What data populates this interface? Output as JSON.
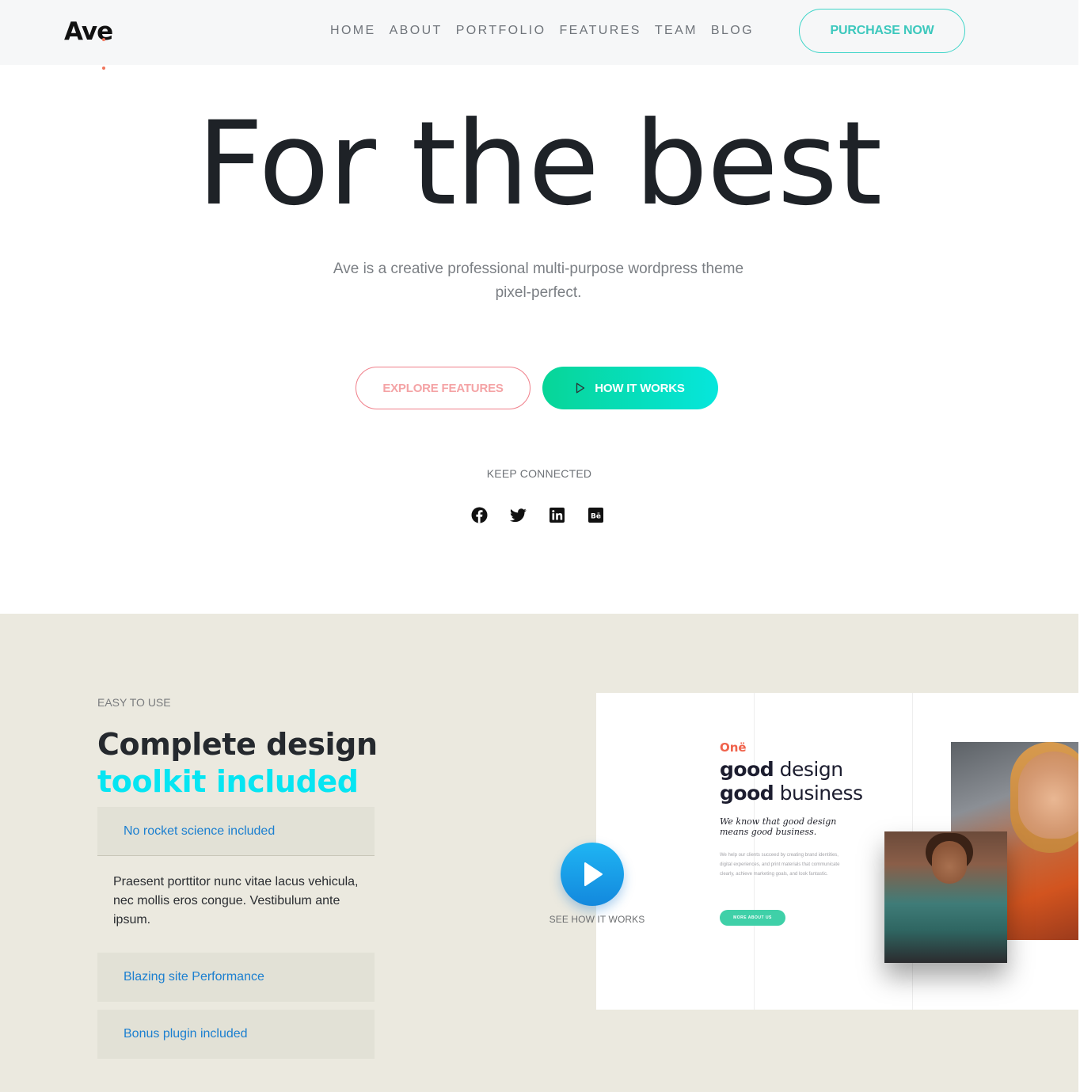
{
  "header": {
    "logo": "Ave",
    "nav": [
      "HOME",
      "ABOUT",
      "PORTFOLIO",
      "FEATURES",
      "TEAM",
      "BLOG"
    ],
    "purchase_label": "PURCHASE NOW"
  },
  "hero": {
    "title": "For the best",
    "subtitle_line1": "Ave is a creative professional multi-purpose wordpress theme",
    "subtitle_line2": "pixel-perfect.",
    "explore_label": "EXPLORE FEATURES",
    "how_label": "HOW IT WORKS",
    "keep_connected": "KEEP CONNECTED",
    "social_icons": [
      "facebook-icon",
      "twitter-icon",
      "linkedin-icon",
      "behance-icon"
    ]
  },
  "features": {
    "eyebrow": "EASY TO USE",
    "heading_line1": "Complete design",
    "heading_line2": "toolkit included",
    "accordion": [
      {
        "label": "No rocket science included",
        "body": "Praesent porttitor nunc vitae lacus vehicula, nec mollis eros congue. Vestibulum ante ipsum."
      },
      {
        "label": "Blazing site Performance"
      },
      {
        "label": "Bonus plugin included"
      }
    ],
    "video_label": "SEE HOW IT WORKS",
    "mockup": {
      "logo": "Onë",
      "line1_bold": "good",
      "line1_rest": " design",
      "line2_bold": "good",
      "line2_rest": " business",
      "tagline_line1": "We know that good design",
      "tagline_line2": "means good business.",
      "body": "We help our clients succeed by creating brand identities, digital experiences, and print materials that communicate clearly, achieve marketing goals, and look fantastic.",
      "button": "MORE ABOUT US"
    }
  },
  "colors": {
    "accent_teal": "#3fd5c9",
    "accent_cyan": "#06e5f2",
    "accent_pink": "#f07f8a",
    "link_blue": "#1b7fd0",
    "section_bg": "#ebe9df"
  }
}
